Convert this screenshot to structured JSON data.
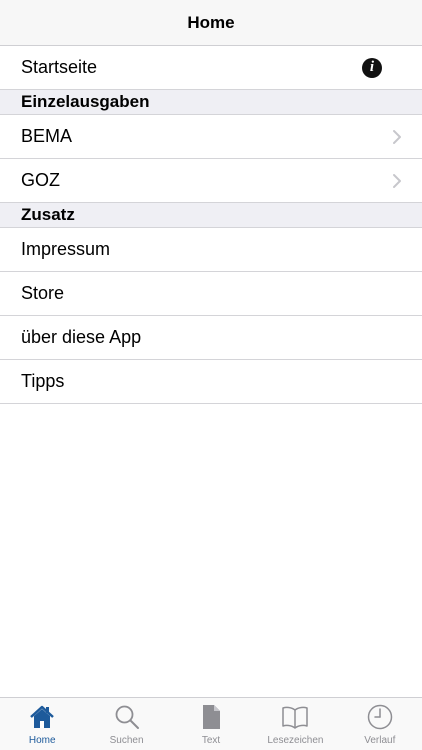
{
  "navbar": {
    "title": "Home"
  },
  "rows": {
    "startseite": "Startseite",
    "section1": "Einzelausgaben",
    "bema": "BEMA",
    "goz": "GOZ",
    "section2": "Zusatz",
    "impressum": "Impressum",
    "store": "Store",
    "about": "über diese App",
    "tipps": "Tipps"
  },
  "info_icon": {
    "name": "info-icon",
    "glyph": "i"
  },
  "tabbar": {
    "tabs": [
      {
        "label": "Home",
        "icon": "house-icon",
        "active": true
      },
      {
        "label": "Suchen",
        "icon": "magnifier-icon",
        "active": false
      },
      {
        "label": "Text",
        "icon": "document-icon",
        "active": false
      },
      {
        "label": "Lesezeichen",
        "icon": "book-icon",
        "active": false
      },
      {
        "label": "Verlauf",
        "icon": "clock-icon",
        "active": false
      }
    ]
  },
  "colors": {
    "accent": "#1d5a9b",
    "inactive": "#8e8e93",
    "section_bg": "#efeff4"
  }
}
